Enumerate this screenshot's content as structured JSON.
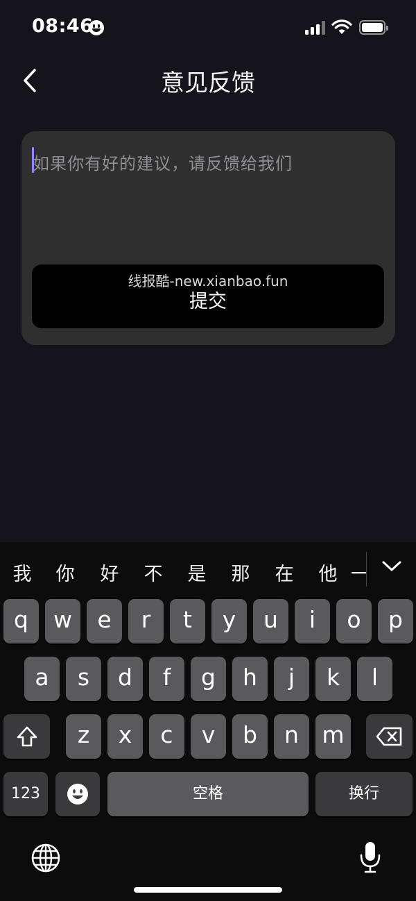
{
  "status": {
    "time": "08:46"
  },
  "nav": {
    "title": "意见反馈"
  },
  "feedback": {
    "placeholder": "如果你有好的建议，请反馈给我们",
    "watermark": "线报酷-new.xianbao.fun",
    "submit_label": "提交"
  },
  "keyboard": {
    "candidates": [
      "我",
      "你",
      "好",
      "不",
      "是",
      "那",
      "在",
      "他",
      "一"
    ],
    "row1": [
      "q",
      "w",
      "e",
      "r",
      "t",
      "y",
      "u",
      "i",
      "o",
      "p"
    ],
    "row2": [
      "a",
      "s",
      "d",
      "f",
      "g",
      "h",
      "j",
      "k",
      "l"
    ],
    "row3": [
      "z",
      "x",
      "c",
      "v",
      "b",
      "n",
      "m"
    ],
    "numbers_label": "123",
    "space_label": "空格",
    "return_label": "换行"
  },
  "icons": {
    "back": "chevron-left-icon",
    "shift": "shift-icon",
    "delete": "delete-icon",
    "emoji": "emoji-icon",
    "globe": "globe-icon",
    "mic": "microphone-icon",
    "collapse": "chevron-down-icon"
  },
  "colors": {
    "background": "#15131c",
    "card": "#2f2f2f",
    "caret": "#8f86ff",
    "key": "#5a5a5c",
    "key_fn": "#3a3a3c"
  }
}
